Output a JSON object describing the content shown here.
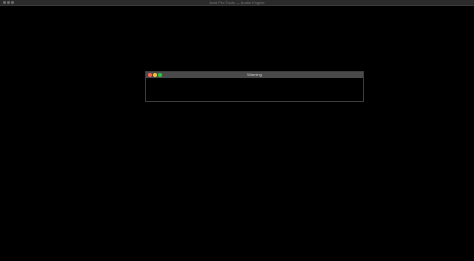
{
  "main_window": {
    "title": "Avid Pro Tools — Audio Engine",
    "traffic_light_color": "#6a6a6a"
  },
  "dialog": {
    "title": "Warning",
    "close_color": "#ff5f57",
    "minimize_color": "#febc2e",
    "zoom_color": "#28c840",
    "message": ""
  }
}
